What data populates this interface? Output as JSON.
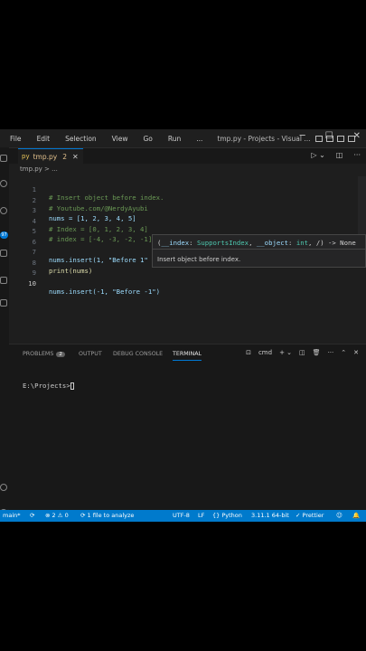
{
  "menubar": {
    "items": [
      "File",
      "Edit",
      "Selection",
      "View",
      "Go",
      "Run",
      "..."
    ]
  },
  "window": {
    "title": "tmp.py - Projects - Visual ..."
  },
  "tab": {
    "icon": "py",
    "name": "tmp.py",
    "modified": "2",
    "close": "✕"
  },
  "breadcrumb": {
    "text": "tmp.py > ..."
  },
  "code_lines": [
    {
      "num": "1",
      "text": "# Insert object before index."
    },
    {
      "num": "2",
      "text": "# Youtube.com/@NerdyAyubi"
    },
    {
      "num": "3",
      "text": "nums = [1, 2, 3, 4, 5]"
    },
    {
      "num": "4",
      "text": "# Index = [0, 1, 2, 3, 4]"
    },
    {
      "num": "5",
      "text": "# index = [-4, -3, -2, -1]"
    },
    {
      "num": "6",
      "text": ""
    },
    {
      "num": "7",
      "text": "nums.insert(1, \"Before 1\""
    },
    {
      "num": "8",
      "text": "print(nums)"
    },
    {
      "num": "9",
      "text": ""
    },
    {
      "num": "10",
      "text": "nums.insert(-1, \"Before -1\")"
    }
  ],
  "hover": {
    "signature_parts": [
      "(",
      "__index",
      ": ",
      "SupportsIndex",
      ", ",
      "__object",
      ": ",
      "int",
      ", /) -> None"
    ],
    "doc": "Insert object before index."
  },
  "panel": {
    "tabs": [
      "PROBLEMS",
      "OUTPUT",
      "DEBUG CONSOLE",
      "TERMINAL"
    ],
    "problems_count": "2",
    "terminal_shell": "cmd",
    "terminal_prompt": "E:\\Projects>"
  },
  "statusbar": {
    "branch": "main*",
    "sync": "⟳",
    "errors": "⊗ 2 ⚠ 0",
    "analyze": "⟳ 1 file to analyze",
    "encoding": "UTF-8",
    "eol": "LF",
    "language": "{} Python",
    "interpreter": "3.11.1 64-bit",
    "formatter": "✓ Prettier"
  },
  "colors": {
    "accent": "#0078d4",
    "statusbar": "#007acc"
  }
}
